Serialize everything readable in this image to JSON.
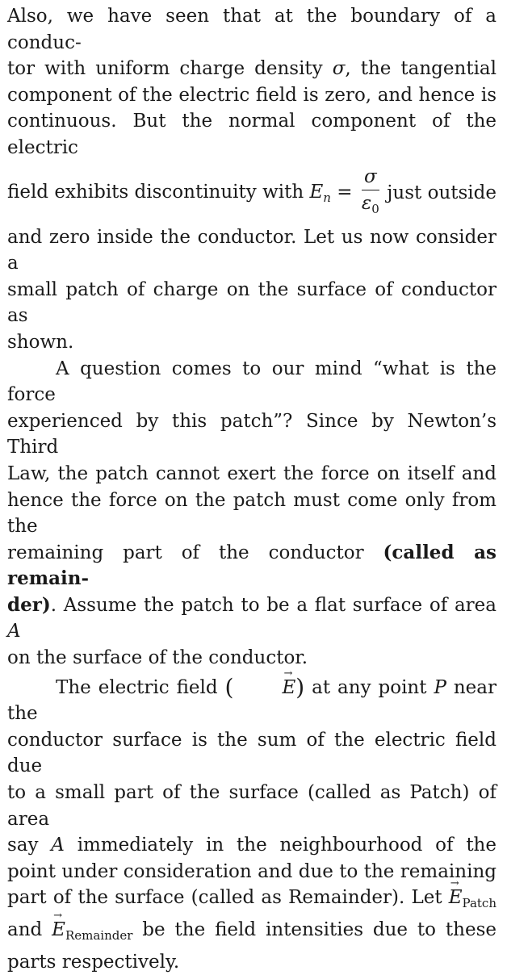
{
  "paragraphs": {
    "p1": {
      "l1": "Also, we have seen that at the boundary of a conduc-",
      "l2a": "tor with uniform charge density ",
      "sigma": "σ",
      "l2b": ", the tangential",
      "l3": "component of the electric field is zero, and hence is",
      "l4": "continuous. But the normal component of the electric",
      "l5a": "field exhibits discontinuity with ",
      "En": "E",
      "En_sub": "n",
      "eq": " = ",
      "frac_num": "σ",
      "frac_den": "ε",
      "frac_den_sub": "0",
      "l5b": " just outside",
      "l6": "and zero inside the conductor. Let us now consider a",
      "l7": "small patch of charge on the surface of conductor as",
      "l8": "shown."
    },
    "p2": {
      "l1": "A question comes to our mind “what is the force",
      "l2": "experienced by this patch”? Since by Newton’s Third",
      "l3": "Law, the patch cannot exert the force on itself and",
      "l4": "hence the force on the patch must come only from the",
      "l5a": "remaining part of the conductor ",
      "l5bold": "(called as remain-",
      "l6bold": "der)",
      "l6b": ". Assume the patch to be a flat surface of area ",
      "A": "A",
      "l7": "on the surface of the conductor."
    },
    "p3": {
      "l1a": "The electric field ",
      "paren_open": "(",
      "E": "E",
      "paren_close": ")",
      "l1b": " at any point ",
      "P": "P",
      "l1c": " near the",
      "l2": "conductor surface is the sum of the electric field due",
      "l3": "to a small part of the surface (called as Patch) of area",
      "l4a": "say ",
      "A": "A",
      "l4b": " immediately in the neighbourhood of the",
      "l5": "point under consideration and due to the remaining",
      "l6a": "part of the surface (called as Remainder). Let ",
      "E_patch": "E",
      "E_patch_sub": "Patch",
      "l7a": "and ",
      "E_rem": "E",
      "E_rem_sub": "Remainder",
      "l7b": " be the field intensities due to these",
      "l8": "parts respectively."
    }
  }
}
